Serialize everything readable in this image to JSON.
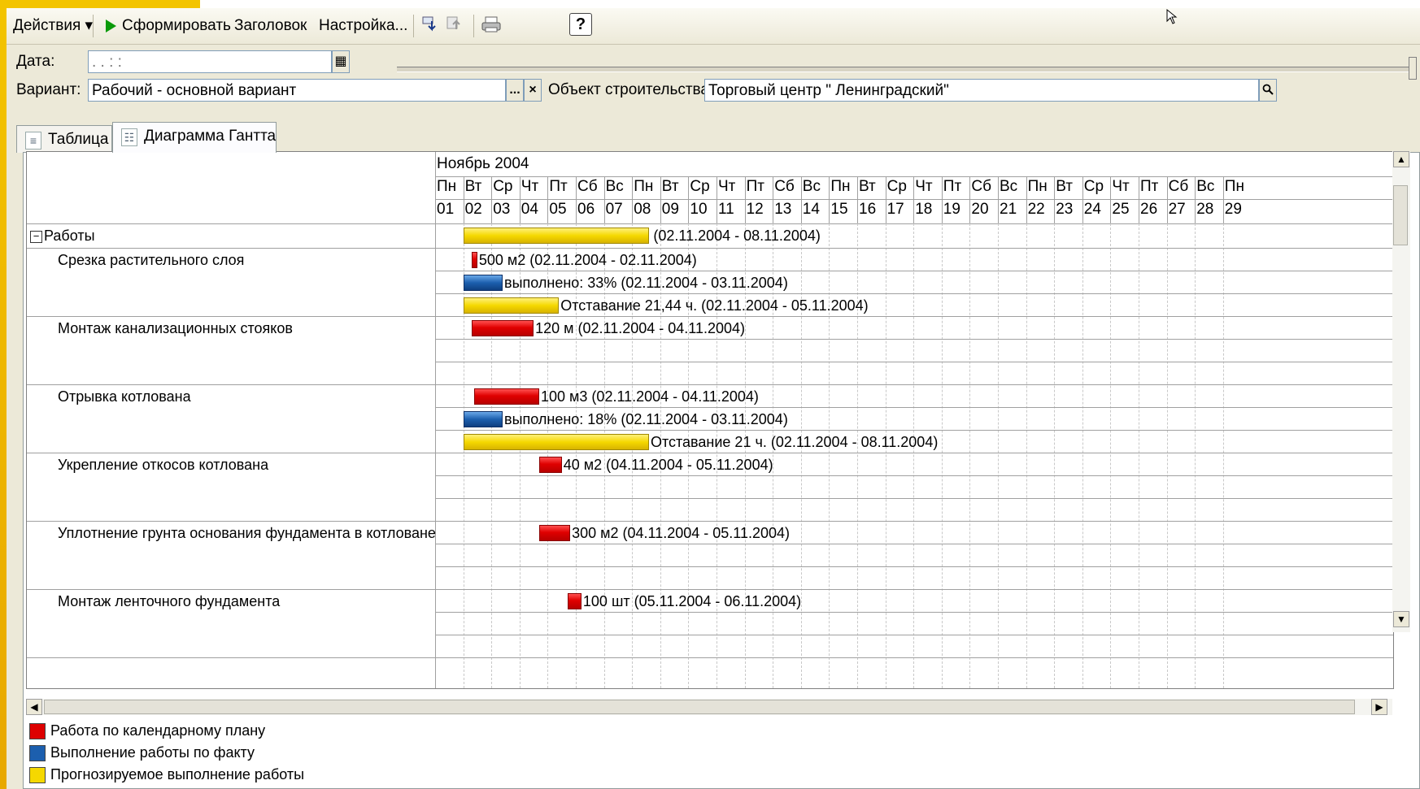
{
  "toolbar": {
    "actions_label": "Действия ▾",
    "generate_label": "Сформировать",
    "header_label": "Заголовок",
    "settings_label": "Настройка...",
    "help_label": "?"
  },
  "form": {
    "date_label": "Дата:",
    "date_value": " .  .      :  :",
    "variant_label": "Вариант:",
    "variant_value": "Рабочий - основной вариант",
    "variant_select_button": "...",
    "variant_clear_button": "×",
    "object_label": "Объект строительства:",
    "object_value": "Торговый центр \" Ленинградский\""
  },
  "tabs": [
    {
      "label": "Таблица"
    },
    {
      "label": "Диаграмма Гантта"
    }
  ],
  "gantt": {
    "month": "Ноябрь 2004",
    "weekdays": [
      "Пн",
      "Вт",
      "Ср",
      "Чт",
      "Пт",
      "Сб",
      "Вс",
      "Пн",
      "Вт",
      "Ср",
      "Чт",
      "Пт",
      "Сб",
      "Вс",
      "Пн",
      "Вт",
      "Ср",
      "Чт",
      "Пт",
      "Сб",
      "Вс",
      "Пн",
      "Вт",
      "Ср",
      "Чт",
      "Пт",
      "Сб",
      "Вс",
      "Пн"
    ],
    "days": [
      "01",
      "02",
      "03",
      "04",
      "05",
      "06",
      "07",
      "08",
      "09",
      "10",
      "11",
      "12",
      "13",
      "14",
      "15",
      "16",
      "17",
      "18",
      "19",
      "20",
      "21",
      "22",
      "23",
      "24",
      "25",
      "26",
      "27",
      "28",
      "29"
    ],
    "group_label": "Работы",
    "group_toggle": "−",
    "group_bar_text": "(02.11.2004 - 08.11.2004)",
    "tasks": [
      {
        "name": "Срезка растительного слоя",
        "plan": "500 м2 (02.11.2004 - 02.11.2004)",
        "fact": "выполнено: 33% (02.11.2004 - 03.11.2004)",
        "forecast": "Отставание 21,44 ч. (02.11.2004 - 05.11.2004)"
      },
      {
        "name": "Монтаж канализационных стояков",
        "plan": "120 м (02.11.2004 - 04.11.2004)"
      },
      {
        "name": "Отрывка котлована",
        "plan": "100 м3 (02.11.2004 - 04.11.2004)",
        "fact": "выполнено: 18% (02.11.2004 - 03.11.2004)",
        "forecast": "Отставание 21 ч. (02.11.2004 - 08.11.2004)"
      },
      {
        "name": "Укрепление откосов котлована",
        "plan": "40 м2 (04.11.2004 - 05.11.2004)"
      },
      {
        "name": "Уплотнение грунта основания фундамента в котловане",
        "plan": "300 м2 (04.11.2004 - 05.11.2004)"
      },
      {
        "name": "Монтаж ленточного фундамента",
        "plan": "100 шт (05.11.2004 - 06.11.2004)"
      }
    ]
  },
  "legend": [
    {
      "label": "Работа по календарному плану",
      "color": "#dd0000"
    },
    {
      "label": "Выполнение работы по факту",
      "color": "#1c5fae"
    },
    {
      "label": "Прогнозируемое выполнение работы",
      "color": "#f5d800"
    }
  ]
}
